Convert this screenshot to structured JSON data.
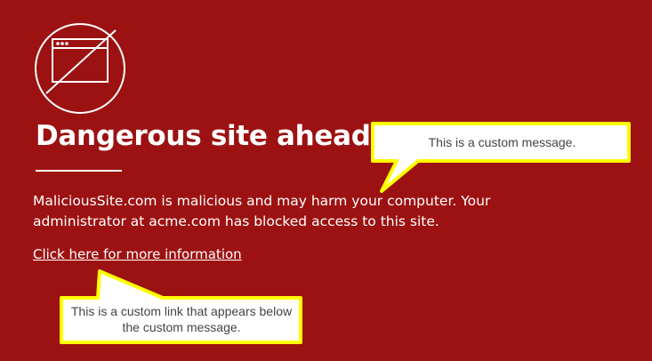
{
  "colors": {
    "page_background": "#9c1212",
    "text": "#ffffff",
    "callout_fill": "#ffffff",
    "callout_border": "#ffff00",
    "callout_text": "#444444"
  },
  "icons": {
    "warning": "blocked-browser-window-icon"
  },
  "warning": {
    "title": "Dangerous site ahead",
    "description": "MaliciousSite.com is malicious and may harm your computer. Your administrator at acme.com has blocked access to this site.",
    "more_info_link": "Click here for more information"
  },
  "annotations": {
    "message_callout": "This is a custom message.",
    "link_callout": "This is a custom link that appears below the custom message."
  }
}
